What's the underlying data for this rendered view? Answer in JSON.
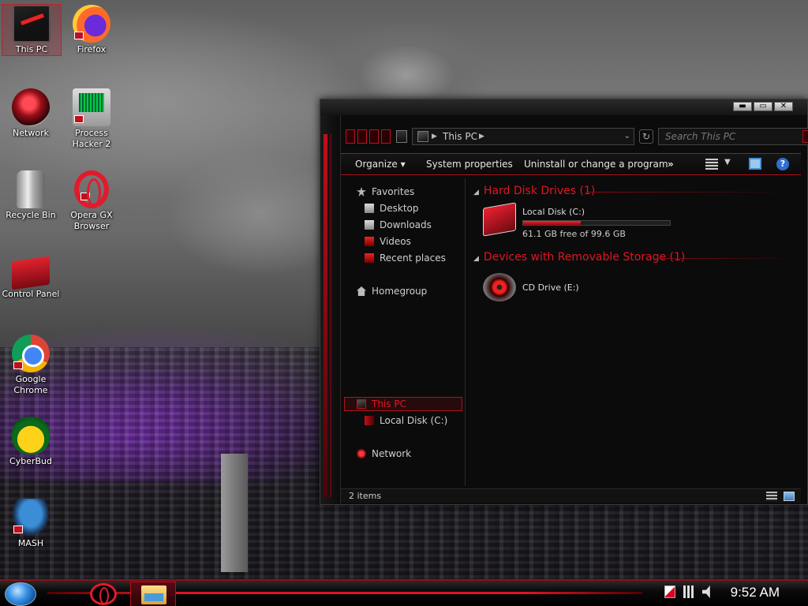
{
  "desktop": {
    "icons": [
      {
        "label": "This PC",
        "icon": "computer-icon"
      },
      {
        "label": "Firefox",
        "icon": "firefox-icon"
      },
      {
        "label": "Network",
        "icon": "network-icon"
      },
      {
        "label": "Process Hacker 2",
        "icon": "process-hacker-icon"
      },
      {
        "label": "Recycle Bin",
        "icon": "recycle-bin-icon"
      },
      {
        "label": "Opera GX Browser",
        "icon": "opera-gx-icon"
      },
      {
        "label": "Control Panel",
        "icon": "control-panel-icon"
      },
      {
        "label": "Google Chrome",
        "icon": "chrome-icon"
      },
      {
        "label": "CyberBud",
        "icon": "cyberbud-icon"
      },
      {
        "label": "MASH",
        "icon": "mash-icon"
      }
    ]
  },
  "window": {
    "controls": {
      "minimize": "▬",
      "maximize": "▭",
      "close": "✕"
    },
    "address": {
      "location": "This PC"
    },
    "search": {
      "placeholder": "Search This PC"
    },
    "toolbar": {
      "organize": "Organize ▾",
      "system_properties": "System properties",
      "uninstall": "Uninstall or change a program",
      "more": "»"
    },
    "nav": {
      "favorites": "Favorites",
      "desktop": "Desktop",
      "downloads": "Downloads",
      "videos": "Videos",
      "recent_places": "Recent places",
      "homegroup": "Homegroup",
      "this_pc": "This PC",
      "local_disk": "Local Disk (C:)",
      "network": "Network"
    },
    "groups": {
      "hard_disk": "Hard Disk Drives (1)",
      "removable": "Devices with Removable Storage (1)"
    },
    "drives": {
      "c": {
        "name": "Local Disk (C:)",
        "free_text": "61.1 GB free of 99.6 GB",
        "used_fraction": 0.39
      },
      "e": {
        "name": "CD Drive (E:)"
      }
    },
    "status": {
      "items": "2 items"
    }
  },
  "taskbar": {
    "clock": "9:52 AM",
    "accent": "#e01622"
  }
}
